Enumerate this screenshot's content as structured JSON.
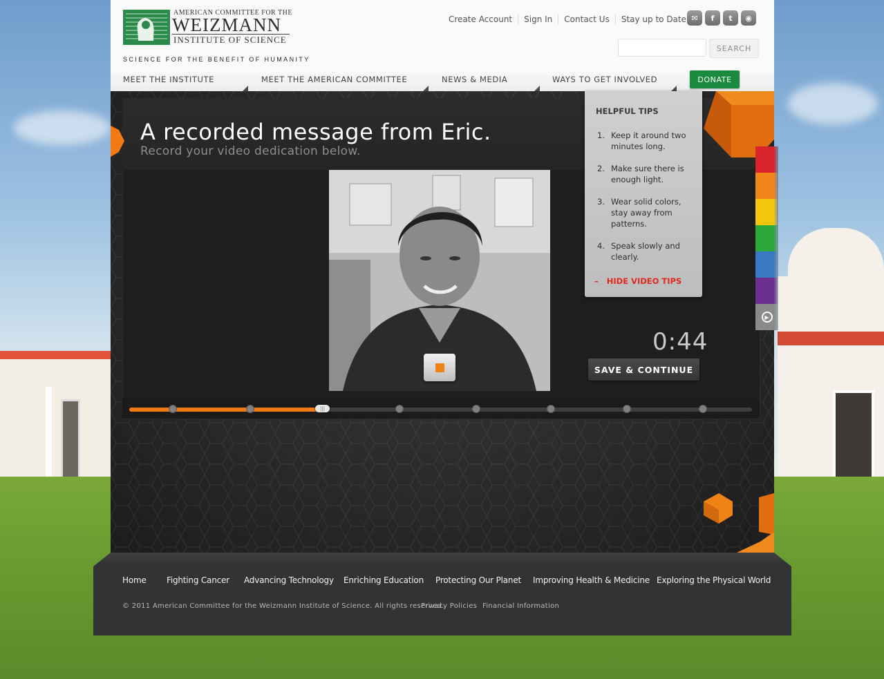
{
  "brand": {
    "logo_line1": "AMERICAN COMMITTEE FOR THE",
    "logo_line2": "WEIZMANN",
    "logo_line3": "INSTITUTE OF SCIENCE",
    "tagline": "SCIENCE FOR THE BENEFIT OF HUMANITY"
  },
  "top_links": {
    "create_account": "Create Account",
    "sign_in": "Sign In",
    "contact_us": "Contact Us",
    "stay_up_to_date": "Stay up to Date:"
  },
  "social_icons": [
    "email-icon",
    "facebook-icon",
    "twitter-icon",
    "rss-icon"
  ],
  "search": {
    "placeholder": "",
    "button": "SEARCH"
  },
  "nav": {
    "items": [
      "MEET THE INSTITUTE",
      "MEET THE AMERICAN COMMITTEE",
      "NEWS & MEDIA",
      "WAYS TO GET INVOLVED"
    ],
    "donate": "DONATE"
  },
  "recorder": {
    "title": "A recorded message from Eric.",
    "subtitle": "Record your video dedication below.",
    "timer": "0:44",
    "save_button": "SAVE & CONTINUE",
    "record_button_icon": "stop-icon",
    "progress_fraction": 0.31,
    "progress_steps": 9
  },
  "tips": {
    "title": "HELPFUL TIPS",
    "items": [
      {
        "num": "1.",
        "text": "Keep it around two minutes long."
      },
      {
        "num": "2.",
        "text": "Make sure there is enough light."
      },
      {
        "num": "3.",
        "text": "Wear solid colors, stay away from patterns."
      },
      {
        "num": "4.",
        "text": "Speak slowly and clearly."
      }
    ],
    "hide_dash": "–",
    "hide": "HIDE VIDEO TIPS"
  },
  "side_tabs": {
    "colors": [
      "#d8232a",
      "#f3851d",
      "#f5c60e",
      "#2ea83c",
      "#3b78c4",
      "#6b2f8e",
      "#8a8a8a"
    ],
    "last_icon": "play-icon"
  },
  "footer": {
    "nav": [
      "Home",
      "Fighting Cancer",
      "Advancing Technology",
      "Enriching Education",
      "Protecting Our Planet",
      "Improving Health & Medicine",
      "Exploring the Physical World"
    ],
    "copyright": "© 2011 American Committee for the Weizmann Institute of Science. All rights reserved.",
    "privacy": "Privacy Policies",
    "financial": "Financial Information"
  },
  "colors": {
    "accent_orange": "#f07a14",
    "donate_green": "#1a8a3e",
    "hide_tips_red": "#e02a1e"
  }
}
